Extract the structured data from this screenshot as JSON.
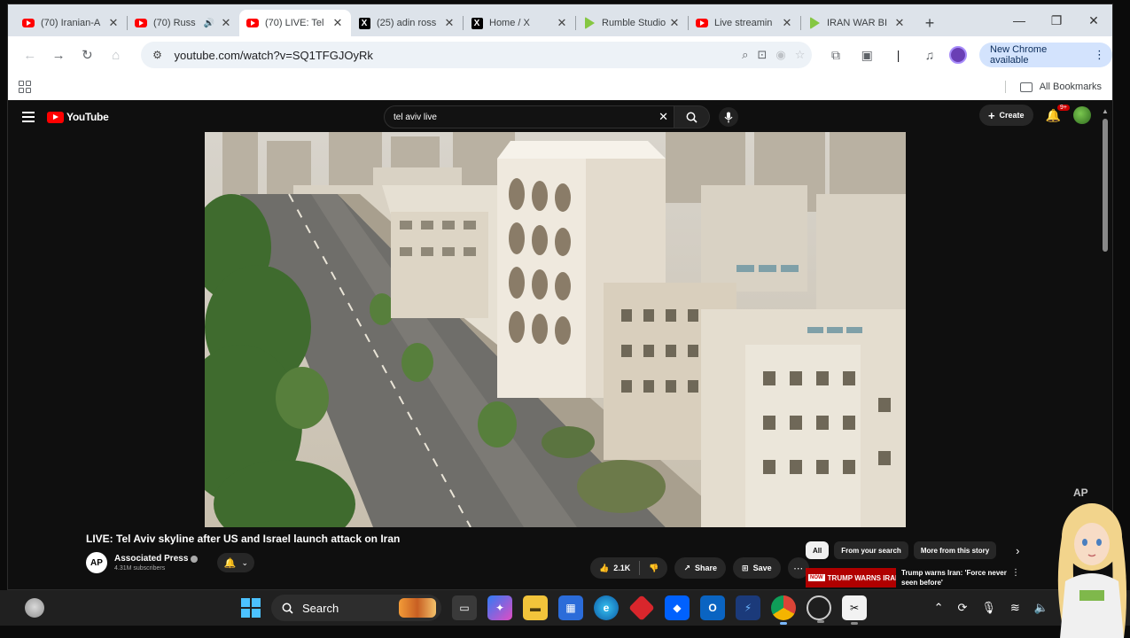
{
  "browser": {
    "tabs": [
      {
        "label": "(70) Iranian-A",
        "favicon": "youtube"
      },
      {
        "label": "(70) Russ",
        "favicon": "youtube",
        "audio": true
      },
      {
        "label": "(70) LIVE: Tel",
        "favicon": "youtube",
        "active": true
      },
      {
        "label": "(25) adin ross",
        "favicon": "x"
      },
      {
        "label": "Home / X",
        "favicon": "x"
      },
      {
        "label": "Rumble Studio",
        "favicon": "rumble"
      },
      {
        "label": "Live streamin",
        "favicon": "youtube"
      },
      {
        "label": "IRAN WAR BI",
        "favicon": "rumble"
      }
    ],
    "url": "youtube.com/watch?v=SQ1TFGJOyRk",
    "new_chrome_label": "New Chrome available",
    "all_bookmarks_label": "All Bookmarks"
  },
  "youtube": {
    "logo_text": "YouTube",
    "search_value": "tel aviv live",
    "create_label": "Create",
    "notification_badge": "9+",
    "video": {
      "title": "LIVE: Tel Aviv skyline after US and Israel launch attack on Iran",
      "channel_name": "Associated Press",
      "channel_logo": "AP",
      "subscribers": "4.31M subscribers",
      "likes": "2.1K",
      "share_label": "Share",
      "save_label": "Save",
      "watermark": "AP"
    },
    "chips": [
      "All",
      "From your search",
      "More from this story"
    ],
    "related": {
      "thumb_tag": "NOW",
      "thumb_text": "TRUMP WARNS IRAN",
      "title": "Trump warns Iran: 'Force never seen before'"
    }
  },
  "taskbar": {
    "search_label": "Search"
  },
  "colors": {
    "yt_red": "#ff0000",
    "chrome_accent": "#d3e3fd",
    "yt_bg": "#0f0f0f"
  }
}
